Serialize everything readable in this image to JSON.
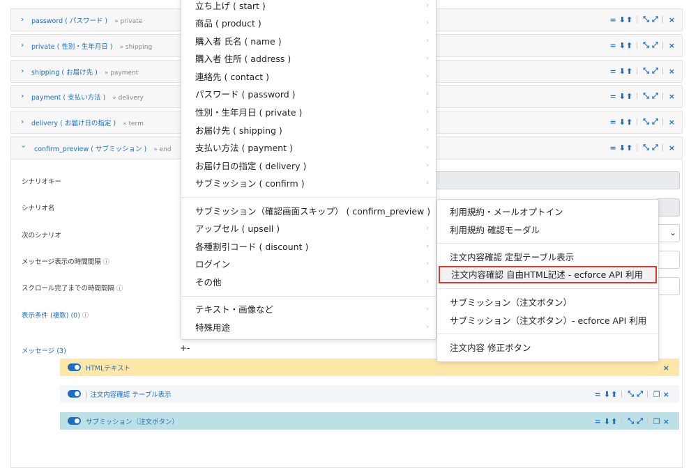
{
  "scenario_rows": [
    {
      "key": "password",
      "label": "password ( パスワード )",
      "next": "» private"
    },
    {
      "key": "private",
      "label": "private ( 性別・生年月日 )",
      "next": "» shipping"
    },
    {
      "key": "shipping",
      "label": "shipping ( お届け先 )",
      "next": "» payment"
    },
    {
      "key": "payment",
      "label": "payment ( 支払い方法 )",
      "next": "» delivery"
    },
    {
      "key": "delivery",
      "label": "delivery ( お届け日の指定 )",
      "next": "» term"
    },
    {
      "key": "confirm_preview",
      "label": "confirm_preview ( サブミッション )",
      "next": "» end"
    }
  ],
  "tools": {
    "equal": "=",
    "down": "⬇",
    "up": "⬆",
    "shrink": "⛶",
    "expand": "⛶",
    "copy": "❐",
    "close": "×"
  },
  "form": {
    "scenario_key_label": "シナリオキー",
    "scenario_name_label": "シナリオ名",
    "next_scenario_label": "次のシナリオ",
    "message_interval_label": "メッセージ表示の時間間隔",
    "scroll_interval_label": "スクロール完了までの時間間隔",
    "display_conditions_label": "表示条件 (複数) (0)",
    "messages_label": "メッセージ (3)",
    "add_label": "+-",
    "info_glyph": "ⓘ",
    "select_arrow": "⌄"
  },
  "messages": [
    {
      "title": "HTMLテキスト",
      "bg": "#fde7a9"
    },
    {
      "title": "注文内容確認 テーブル表示",
      "bg": "#f3f6f8"
    },
    {
      "title": "サブミッション（注文ボタン）",
      "bg": "#bde0e6"
    }
  ],
  "menu": {
    "group1": [
      "立ち上げ ( start )",
      "商品 ( product )",
      "購入者 氏名 ( name )",
      "購入者 住所 ( address )",
      "連絡先 ( contact )",
      "パスワード ( password )",
      "性別・生年月日 ( private )",
      "お届け先 ( shipping )",
      "支払い方法 ( payment )",
      "お届け日の指定 ( delivery )",
      "サブミッション ( confirm )"
    ],
    "group2": [
      "サブミッション（確認画面スキップ） ( confirm_preview )",
      "アップセル ( upsell )",
      "各種割引コード ( discount )",
      "ログイン",
      "その他"
    ],
    "group3": [
      "テキスト・画像など",
      "特殊用途"
    ],
    "arrow": "›"
  },
  "submenu": {
    "group1": [
      "利用規約・メールオプトイン",
      "利用規約 確認モーダル"
    ],
    "group2": [
      "注文内容確認 定型テーブル表示",
      "注文内容確認 自由HTML記述 - ecforce API 利用"
    ],
    "group3": [
      "サブミッション（注文ボタン）",
      "サブミッション（注文ボタン）- ecforce API 利用"
    ],
    "group4": [
      "注文内容 修正ボタン"
    ],
    "highlighted": "注文内容確認 自由HTML記述 - ecforce API 利用",
    "highlight_color": "#e0372b"
  }
}
